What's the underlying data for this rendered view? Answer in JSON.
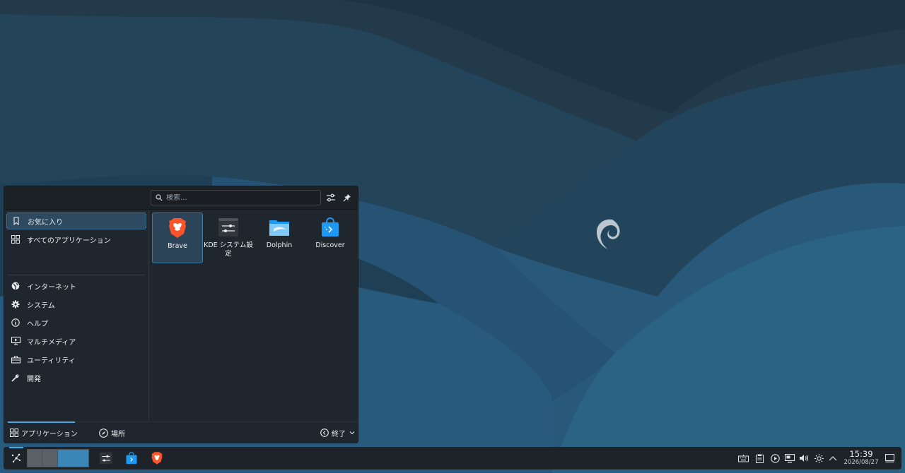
{
  "launcher": {
    "search": {
      "placeholder": "検索..."
    },
    "categories": [
      {
        "label": "お気に入り",
        "icon": "bookmark-icon",
        "active": true
      },
      {
        "label": "すべてのアプリケーション",
        "icon": "grid-icon"
      },
      {
        "label": "インターネット",
        "icon": "globe-icon"
      },
      {
        "label": "システム",
        "icon": "gear-icon"
      },
      {
        "label": "ヘルプ",
        "icon": "info-icon"
      },
      {
        "label": "マルチメディア",
        "icon": "monitor-play-icon"
      },
      {
        "label": "ユーティリティ",
        "icon": "toolbox-icon"
      },
      {
        "label": "開発",
        "icon": "wrench-icon"
      }
    ],
    "favorites": [
      {
        "label": "Brave",
        "icon": "brave-icon"
      },
      {
        "label": "KDE システム設定",
        "icon": "kde-settings-icon"
      },
      {
        "label": "Dolphin",
        "icon": "dolphin-folder-icon"
      },
      {
        "label": "Discover",
        "icon": "discover-icon"
      }
    ],
    "footer": {
      "applications": "アプリケーション",
      "places": "場所",
      "leave": "終了"
    }
  },
  "taskbar": {
    "clock": {
      "time": "15:39",
      "date": "2026/08/27"
    },
    "tray_icons": [
      "keyboard-icon",
      "clipboard-icon",
      "media-play-icon",
      "display-icon",
      "volume-icon",
      "brightness-icon",
      "expand-arrow-icon"
    ]
  },
  "colors": {
    "accent": "#3daee9",
    "panel": "#20262d",
    "wallpaper_base": "#1e3d52"
  }
}
